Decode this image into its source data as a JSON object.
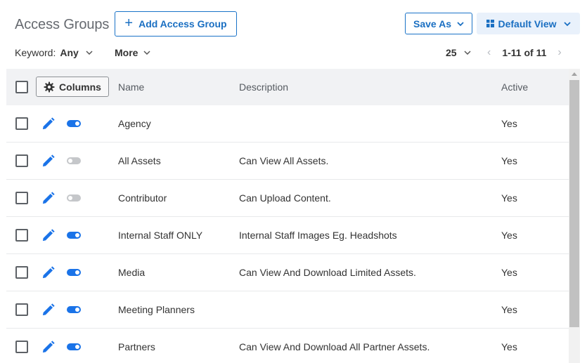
{
  "header": {
    "title": "Access Groups",
    "add_label": "Add Access Group",
    "save_as_label": "Save As",
    "view_label": "Default View"
  },
  "filters": {
    "keyword_label": "Keyword:",
    "keyword_value": "Any",
    "more_label": "More",
    "per_page": "25",
    "range": "1-11 of 11",
    "prev_arrow": "‹",
    "next_arrow": "›"
  },
  "table": {
    "columns_button": "Columns",
    "headers": {
      "name": "Name",
      "description": "Description",
      "active": "Active"
    },
    "rows": [
      {
        "name": "Agency",
        "description": "",
        "active": "Yes",
        "enabled": true
      },
      {
        "name": "All Assets",
        "description": "Can View All Assets.",
        "active": "Yes",
        "enabled": false
      },
      {
        "name": "Contributor",
        "description": "Can Upload Content.",
        "active": "Yes",
        "enabled": false
      },
      {
        "name": "Internal Staff ONLY",
        "description": "Internal Staff Images Eg. Headshots",
        "active": "Yes",
        "enabled": true
      },
      {
        "name": "Media",
        "description": "Can View And Download Limited Assets.",
        "active": "Yes",
        "enabled": true
      },
      {
        "name": "Meeting Planners",
        "description": "",
        "active": "Yes",
        "enabled": true
      },
      {
        "name": "Partners",
        "description": "Can View And Download All Partner Assets.",
        "active": "Yes",
        "enabled": true
      }
    ]
  },
  "colors": {
    "accent": "#1a73e8",
    "toggle_off": "#c5c7ca",
    "header_bg": "#f1f2f4"
  },
  "icons": {
    "add": "plus-icon",
    "dropdown": "chevron-down-icon",
    "view": "grid-icon",
    "columns": "gear-icon",
    "edit": "pencil-icon",
    "toggle": "toggle-switch-icon"
  }
}
